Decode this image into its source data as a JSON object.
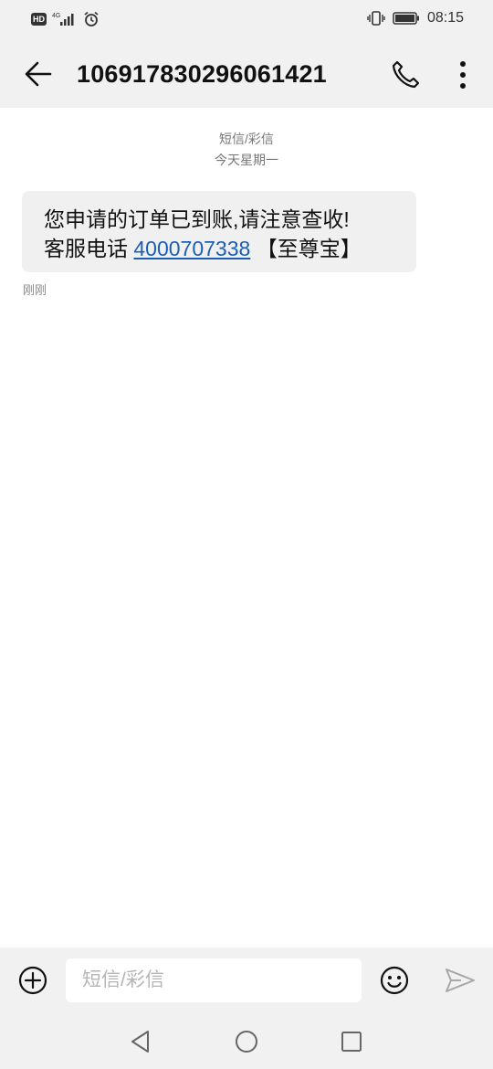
{
  "status_bar": {
    "network_badge": "HD",
    "network_type": "4G",
    "time": "08:15",
    "icons": [
      "hd-icon",
      "signal-icon",
      "alarm-icon",
      "vibrate-icon",
      "battery-icon"
    ]
  },
  "header": {
    "title": "106917830296061421",
    "icons": [
      "back-arrow-icon",
      "phone-icon",
      "more-vertical-icon"
    ]
  },
  "conversation": {
    "type_label": "短信/彩信",
    "date_label": "今天星期一",
    "messages": [
      {
        "line1": "您申请的订单已到账,请注意查收!",
        "line2_prefix": "客服电话 ",
        "phone": "4000707338",
        "line2_suffix": " 【至尊宝】",
        "time": "刚刚"
      }
    ]
  },
  "compose": {
    "placeholder": "短信/彩信",
    "icons": [
      "add-circle-icon",
      "emoji-icon",
      "send-icon"
    ]
  },
  "nav_bar": {
    "icons": [
      "nav-back-icon",
      "nav-home-icon",
      "nav-recents-icon"
    ]
  },
  "colors": {
    "bar_background": "#f1f1f1",
    "bubble_background": "#f0f0f0",
    "link": "#1a5fb4",
    "meta_text": "#777777"
  }
}
